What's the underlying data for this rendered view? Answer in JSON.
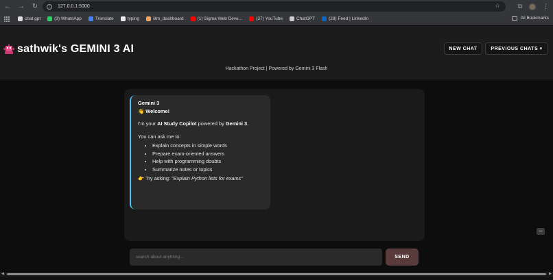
{
  "browser": {
    "url": "127.0.0.1:5000",
    "bookmarks": [
      {
        "label": "chat gpt",
        "color": "#dddddd"
      },
      {
        "label": "(3) WhatsApp",
        "color": "#25d366"
      },
      {
        "label": "Translate",
        "color": "#4285f4"
      },
      {
        "label": "typing",
        "color": "#eeeeee"
      },
      {
        "label": "iitm_dashboard",
        "color": "#f4a261"
      },
      {
        "label": "(1) Sigma Web Deve...",
        "color": "#ff0000"
      },
      {
        "label": "(37) YouTube",
        "color": "#ff0000"
      },
      {
        "label": "ChatGPT",
        "color": "#cccccc"
      },
      {
        "label": "(28) Feed | LinkedIn",
        "color": "#0a66c2"
      }
    ],
    "all_bookmarks": "All Bookmarks"
  },
  "header": {
    "title": "sathwik's GEMINI 3 AI",
    "subtitle": "Hackathon Project | Powered by Gemini 3 Flash",
    "new_chat": "NEW CHAT",
    "previous_chats": "PREVIOUS CHATS ▾"
  },
  "chat": {
    "sender": "Gemini 3",
    "welcome": "Welcome!",
    "intro_prefix": "I'm your ",
    "intro_bold1": "AI Study Copilot",
    "intro_mid": " powered by ",
    "intro_bold2": "Gemini 3",
    "intro_suffix": ".",
    "ask_line": "You can ask me to:",
    "items": [
      "Explain concepts in simple words",
      "Prepare exam-oriented answers",
      "Help with programming doubts",
      "Summarize notes or topics"
    ],
    "try_prefix": "Try asking: ",
    "try_example": "\"Explain Python lists for exams\""
  },
  "composer": {
    "placeholder": "search about anything...",
    "send": "SEND"
  },
  "colors": {
    "accent": "#4fc3f7",
    "send_button": "#5a3b3b"
  }
}
